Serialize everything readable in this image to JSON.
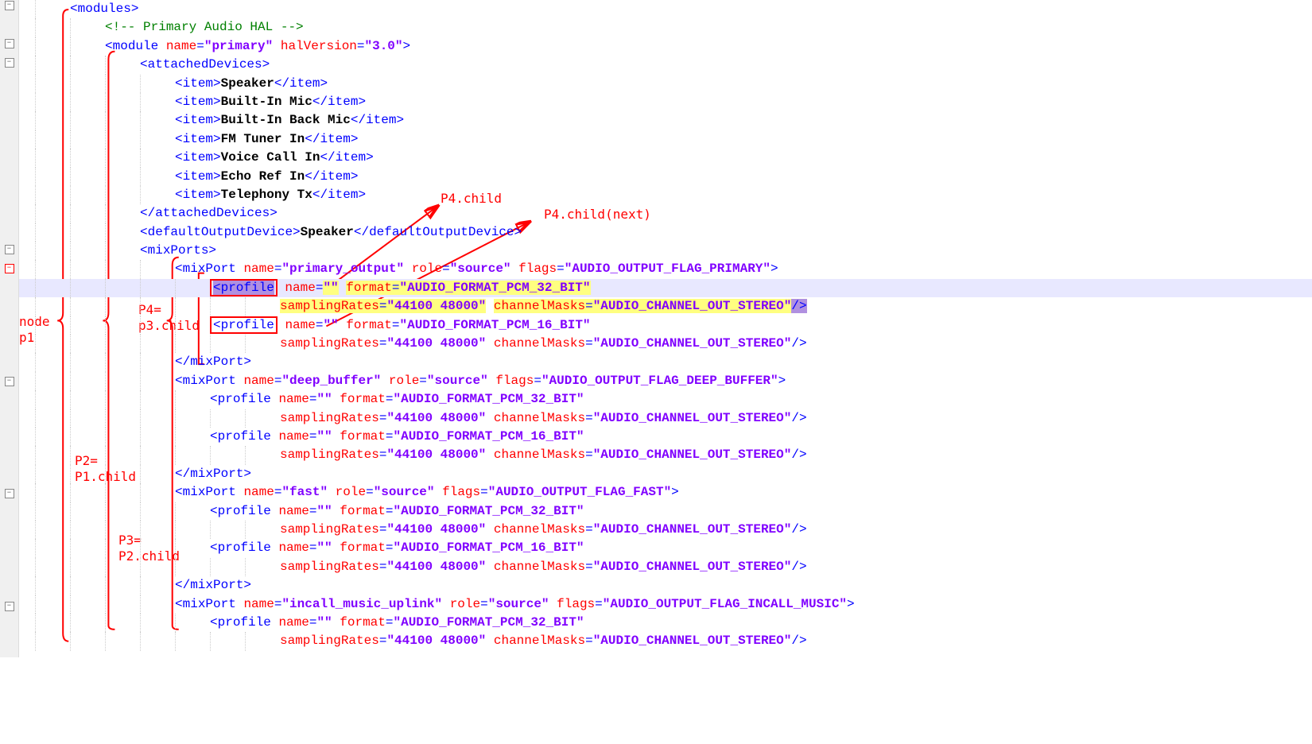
{
  "annotations": {
    "node_p1_a": "node",
    "node_p1_b": "p1",
    "p2_a": "P2=",
    "p2_b": "P1.child",
    "p3_a": "P3=",
    "p3_b": "P2.child",
    "p4_a": "P4=",
    "p4_b": "p3.child",
    "p4_child": "P4.child",
    "p4_child_next": "P4.child(next)"
  },
  "lines": [
    {
      "indent": 1,
      "tokens": [
        {
          "c": "t-bracket",
          "t": "<"
        },
        {
          "c": "t-tag",
          "t": "modules"
        },
        {
          "c": "t-bracket",
          "t": ">"
        }
      ]
    },
    {
      "indent": 2,
      "tokens": [
        {
          "c": "t-comment",
          "t": "<!-- Primary Audio HAL -->"
        }
      ]
    },
    {
      "indent": 2,
      "tokens": [
        {
          "c": "t-bracket",
          "t": "<"
        },
        {
          "c": "t-tag",
          "t": "module"
        },
        {
          "c": "",
          "t": " "
        },
        {
          "c": "t-attr",
          "t": "name"
        },
        {
          "c": "t-tag",
          "t": "="
        },
        {
          "c": "t-str",
          "t": "\"primary\""
        },
        {
          "c": "",
          "t": " "
        },
        {
          "c": "t-attr",
          "t": "halVersion"
        },
        {
          "c": "t-tag",
          "t": "="
        },
        {
          "c": "t-str",
          "t": "\"3.0\""
        },
        {
          "c": "t-bracket",
          "t": ">"
        }
      ]
    },
    {
      "indent": 3,
      "tokens": [
        {
          "c": "t-bracket",
          "t": "<"
        },
        {
          "c": "t-tag",
          "t": "attachedDevices"
        },
        {
          "c": "t-bracket",
          "t": ">"
        }
      ]
    },
    {
      "indent": 4,
      "tokens": [
        {
          "c": "t-bracket",
          "t": "<"
        },
        {
          "c": "t-tag",
          "t": "item"
        },
        {
          "c": "t-bracket",
          "t": ">"
        },
        {
          "c": "t-text",
          "t": "Speaker"
        },
        {
          "c": "t-bracket",
          "t": "</"
        },
        {
          "c": "t-tag",
          "t": "item"
        },
        {
          "c": "t-bracket",
          "t": ">"
        }
      ]
    },
    {
      "indent": 4,
      "tokens": [
        {
          "c": "t-bracket",
          "t": "<"
        },
        {
          "c": "t-tag",
          "t": "item"
        },
        {
          "c": "t-bracket",
          "t": ">"
        },
        {
          "c": "t-text",
          "t": "Built-In Mic"
        },
        {
          "c": "t-bracket",
          "t": "</"
        },
        {
          "c": "t-tag",
          "t": "item"
        },
        {
          "c": "t-bracket",
          "t": ">"
        }
      ]
    },
    {
      "indent": 4,
      "tokens": [
        {
          "c": "t-bracket",
          "t": "<"
        },
        {
          "c": "t-tag",
          "t": "item"
        },
        {
          "c": "t-bracket",
          "t": ">"
        },
        {
          "c": "t-text",
          "t": "Built-In Back Mic"
        },
        {
          "c": "t-bracket",
          "t": "</"
        },
        {
          "c": "t-tag",
          "t": "item"
        },
        {
          "c": "t-bracket",
          "t": ">"
        }
      ]
    },
    {
      "indent": 4,
      "tokens": [
        {
          "c": "t-bracket",
          "t": "<"
        },
        {
          "c": "t-tag",
          "t": "item"
        },
        {
          "c": "t-bracket",
          "t": ">"
        },
        {
          "c": "t-text",
          "t": "FM Tuner In"
        },
        {
          "c": "t-bracket",
          "t": "</"
        },
        {
          "c": "t-tag",
          "t": "item"
        },
        {
          "c": "t-bracket",
          "t": ">"
        }
      ]
    },
    {
      "indent": 4,
      "tokens": [
        {
          "c": "t-bracket",
          "t": "<"
        },
        {
          "c": "t-tag",
          "t": "item"
        },
        {
          "c": "t-bracket",
          "t": ">"
        },
        {
          "c": "t-text",
          "t": "Voice Call In"
        },
        {
          "c": "t-bracket",
          "t": "</"
        },
        {
          "c": "t-tag",
          "t": "item"
        },
        {
          "c": "t-bracket",
          "t": ">"
        }
      ]
    },
    {
      "indent": 4,
      "tokens": [
        {
          "c": "t-bracket",
          "t": "<"
        },
        {
          "c": "t-tag",
          "t": "item"
        },
        {
          "c": "t-bracket",
          "t": ">"
        },
        {
          "c": "t-text",
          "t": "Echo Ref In"
        },
        {
          "c": "t-bracket",
          "t": "</"
        },
        {
          "c": "t-tag",
          "t": "item"
        },
        {
          "c": "t-bracket",
          "t": ">"
        }
      ]
    },
    {
      "indent": 4,
      "tokens": [
        {
          "c": "t-bracket",
          "t": "<"
        },
        {
          "c": "t-tag",
          "t": "item"
        },
        {
          "c": "t-bracket",
          "t": ">"
        },
        {
          "c": "t-text",
          "t": "Telephony Tx"
        },
        {
          "c": "t-bracket",
          "t": "</"
        },
        {
          "c": "t-tag",
          "t": "item"
        },
        {
          "c": "t-bracket",
          "t": ">"
        }
      ]
    },
    {
      "indent": 3,
      "tokens": [
        {
          "c": "t-bracket",
          "t": "</"
        },
        {
          "c": "t-tag",
          "t": "attachedDevices"
        },
        {
          "c": "t-bracket",
          "t": ">"
        }
      ]
    },
    {
      "indent": 3,
      "tokens": [
        {
          "c": "t-bracket",
          "t": "<"
        },
        {
          "c": "t-tag",
          "t": "defaultOutputDevice"
        },
        {
          "c": "t-bracket",
          "t": ">"
        },
        {
          "c": "t-text",
          "t": "Speaker"
        },
        {
          "c": "t-bracket",
          "t": "</"
        },
        {
          "c": "t-tag",
          "t": "defaultOutputDevice"
        },
        {
          "c": "t-bracket",
          "t": ">"
        }
      ]
    },
    {
      "indent": 3,
      "tokens": [
        {
          "c": "t-bracket",
          "t": "<"
        },
        {
          "c": "t-tag",
          "t": "mixPorts"
        },
        {
          "c": "t-bracket",
          "t": ">"
        }
      ]
    },
    {
      "indent": 4,
      "tokens": [
        {
          "c": "t-bracket",
          "t": "<"
        },
        {
          "c": "t-tag",
          "t": "mixPort"
        },
        {
          "c": "",
          "t": " "
        },
        {
          "c": "t-attr",
          "t": "name"
        },
        {
          "c": "t-tag",
          "t": "="
        },
        {
          "c": "t-str",
          "t": "\"primary_output\""
        },
        {
          "c": "",
          "t": " "
        },
        {
          "c": "t-attr",
          "t": "role"
        },
        {
          "c": "t-tag",
          "t": "="
        },
        {
          "c": "t-str",
          "t": "\"source\""
        },
        {
          "c": "",
          "t": " "
        },
        {
          "c": "t-attr",
          "t": "flags"
        },
        {
          "c": "t-tag",
          "t": "="
        },
        {
          "c": "t-str",
          "t": "\"AUDIO_OUTPUT_FLAG_PRIMARY\""
        },
        {
          "c": "t-bracket",
          "t": ">"
        }
      ]
    },
    {
      "indent": 5,
      "highlight": "line",
      "special": "profile1"
    },
    {
      "indent": 7,
      "special": "profile1b"
    },
    {
      "indent": 5,
      "special": "profile2"
    },
    {
      "indent": 7,
      "tokens": [
        {
          "c": "t-attr",
          "t": "samplingRates"
        },
        {
          "c": "t-tag",
          "t": "="
        },
        {
          "c": "t-str",
          "t": "\"44100 48000\""
        },
        {
          "c": "",
          "t": " "
        },
        {
          "c": "t-attr",
          "t": "channelMasks"
        },
        {
          "c": "t-tag",
          "t": "="
        },
        {
          "c": "t-str",
          "t": "\"AUDIO_CHANNEL_OUT_STEREO\""
        },
        {
          "c": "t-bracket",
          "t": "/>"
        }
      ]
    },
    {
      "indent": 4,
      "tokens": [
        {
          "c": "t-bracket",
          "t": "</"
        },
        {
          "c": "t-tag",
          "t": "mixPort"
        },
        {
          "c": "t-bracket",
          "t": ">"
        }
      ]
    },
    {
      "indent": 4,
      "tokens": [
        {
          "c": "t-bracket",
          "t": "<"
        },
        {
          "c": "t-tag",
          "t": "mixPort"
        },
        {
          "c": "",
          "t": " "
        },
        {
          "c": "t-attr",
          "t": "name"
        },
        {
          "c": "t-tag",
          "t": "="
        },
        {
          "c": "t-str",
          "t": "\"deep_buffer\""
        },
        {
          "c": "",
          "t": " "
        },
        {
          "c": "t-attr",
          "t": "role"
        },
        {
          "c": "t-tag",
          "t": "="
        },
        {
          "c": "t-str",
          "t": "\"source\""
        },
        {
          "c": "",
          "t": " "
        },
        {
          "c": "t-attr",
          "t": "flags"
        },
        {
          "c": "t-tag",
          "t": "="
        },
        {
          "c": "t-str",
          "t": "\"AUDIO_OUTPUT_FLAG_DEEP_BUFFER\""
        },
        {
          "c": "t-bracket",
          "t": ">"
        }
      ]
    },
    {
      "indent": 5,
      "tokens": [
        {
          "c": "t-bracket",
          "t": "<"
        },
        {
          "c": "t-tag",
          "t": "profile"
        },
        {
          "c": "",
          "t": " "
        },
        {
          "c": "t-attr",
          "t": "name"
        },
        {
          "c": "t-tag",
          "t": "="
        },
        {
          "c": "t-str",
          "t": "\"\""
        },
        {
          "c": "",
          "t": " "
        },
        {
          "c": "t-attr",
          "t": "format"
        },
        {
          "c": "t-tag",
          "t": "="
        },
        {
          "c": "t-str",
          "t": "\"AUDIO_FORMAT_PCM_32_BIT\""
        }
      ]
    },
    {
      "indent": 7,
      "tokens": [
        {
          "c": "t-attr",
          "t": "samplingRates"
        },
        {
          "c": "t-tag",
          "t": "="
        },
        {
          "c": "t-str",
          "t": "\"44100 48000\""
        },
        {
          "c": "",
          "t": " "
        },
        {
          "c": "t-attr",
          "t": "channelMasks"
        },
        {
          "c": "t-tag",
          "t": "="
        },
        {
          "c": "t-str",
          "t": "\"AUDIO_CHANNEL_OUT_STEREO\""
        },
        {
          "c": "t-bracket",
          "t": "/>"
        }
      ]
    },
    {
      "indent": 5,
      "tokens": [
        {
          "c": "t-bracket",
          "t": "<"
        },
        {
          "c": "t-tag",
          "t": "profile"
        },
        {
          "c": "",
          "t": " "
        },
        {
          "c": "t-attr",
          "t": "name"
        },
        {
          "c": "t-tag",
          "t": "="
        },
        {
          "c": "t-str",
          "t": "\"\""
        },
        {
          "c": "",
          "t": " "
        },
        {
          "c": "t-attr",
          "t": "format"
        },
        {
          "c": "t-tag",
          "t": "="
        },
        {
          "c": "t-str",
          "t": "\"AUDIO_FORMAT_PCM_16_BIT\""
        }
      ]
    },
    {
      "indent": 7,
      "tokens": [
        {
          "c": "t-attr",
          "t": "samplingRates"
        },
        {
          "c": "t-tag",
          "t": "="
        },
        {
          "c": "t-str",
          "t": "\"44100 48000\""
        },
        {
          "c": "",
          "t": " "
        },
        {
          "c": "t-attr",
          "t": "channelMasks"
        },
        {
          "c": "t-tag",
          "t": "="
        },
        {
          "c": "t-str",
          "t": "\"AUDIO_CHANNEL_OUT_STEREO\""
        },
        {
          "c": "t-bracket",
          "t": "/>"
        }
      ]
    },
    {
      "indent": 4,
      "tokens": [
        {
          "c": "t-bracket",
          "t": "</"
        },
        {
          "c": "t-tag",
          "t": "mixPort"
        },
        {
          "c": "t-bracket",
          "t": ">"
        }
      ]
    },
    {
      "indent": 4,
      "tokens": [
        {
          "c": "t-bracket",
          "t": "<"
        },
        {
          "c": "t-tag",
          "t": "mixPort"
        },
        {
          "c": "",
          "t": " "
        },
        {
          "c": "t-attr",
          "t": "name"
        },
        {
          "c": "t-tag",
          "t": "="
        },
        {
          "c": "t-str",
          "t": "\"fast\""
        },
        {
          "c": "",
          "t": " "
        },
        {
          "c": "t-attr",
          "t": "role"
        },
        {
          "c": "t-tag",
          "t": "="
        },
        {
          "c": "t-str",
          "t": "\"source\""
        },
        {
          "c": "",
          "t": " "
        },
        {
          "c": "t-attr",
          "t": "flags"
        },
        {
          "c": "t-tag",
          "t": "="
        },
        {
          "c": "t-str",
          "t": "\"AUDIO_OUTPUT_FLAG_FAST\""
        },
        {
          "c": "t-bracket",
          "t": ">"
        }
      ]
    },
    {
      "indent": 5,
      "tokens": [
        {
          "c": "t-bracket",
          "t": "<"
        },
        {
          "c": "t-tag",
          "t": "profile"
        },
        {
          "c": "",
          "t": " "
        },
        {
          "c": "t-attr",
          "t": "name"
        },
        {
          "c": "t-tag",
          "t": "="
        },
        {
          "c": "t-str",
          "t": "\"\""
        },
        {
          "c": "",
          "t": " "
        },
        {
          "c": "t-attr",
          "t": "format"
        },
        {
          "c": "t-tag",
          "t": "="
        },
        {
          "c": "t-str",
          "t": "\"AUDIO_FORMAT_PCM_32_BIT\""
        }
      ]
    },
    {
      "indent": 7,
      "tokens": [
        {
          "c": "t-attr",
          "t": "samplingRates"
        },
        {
          "c": "t-tag",
          "t": "="
        },
        {
          "c": "t-str",
          "t": "\"44100 48000\""
        },
        {
          "c": "",
          "t": " "
        },
        {
          "c": "t-attr",
          "t": "channelMasks"
        },
        {
          "c": "t-tag",
          "t": "="
        },
        {
          "c": "t-str",
          "t": "\"AUDIO_CHANNEL_OUT_STEREO\""
        },
        {
          "c": "t-bracket",
          "t": "/>"
        }
      ]
    },
    {
      "indent": 5,
      "tokens": [
        {
          "c": "t-bracket",
          "t": "<"
        },
        {
          "c": "t-tag",
          "t": "profile"
        },
        {
          "c": "",
          "t": " "
        },
        {
          "c": "t-attr",
          "t": "name"
        },
        {
          "c": "t-tag",
          "t": "="
        },
        {
          "c": "t-str",
          "t": "\"\""
        },
        {
          "c": "",
          "t": " "
        },
        {
          "c": "t-attr",
          "t": "format"
        },
        {
          "c": "t-tag",
          "t": "="
        },
        {
          "c": "t-str",
          "t": "\"AUDIO_FORMAT_PCM_16_BIT\""
        }
      ]
    },
    {
      "indent": 7,
      "tokens": [
        {
          "c": "t-attr",
          "t": "samplingRates"
        },
        {
          "c": "t-tag",
          "t": "="
        },
        {
          "c": "t-str",
          "t": "\"44100 48000\""
        },
        {
          "c": "",
          "t": " "
        },
        {
          "c": "t-attr",
          "t": "channelMasks"
        },
        {
          "c": "t-tag",
          "t": "="
        },
        {
          "c": "t-str",
          "t": "\"AUDIO_CHANNEL_OUT_STEREO\""
        },
        {
          "c": "t-bracket",
          "t": "/>"
        }
      ]
    },
    {
      "indent": 4,
      "tokens": [
        {
          "c": "t-bracket",
          "t": "</"
        },
        {
          "c": "t-tag",
          "t": "mixPort"
        },
        {
          "c": "t-bracket",
          "t": ">"
        }
      ]
    },
    {
      "indent": 4,
      "tokens": [
        {
          "c": "t-bracket",
          "t": "<"
        },
        {
          "c": "t-tag",
          "t": "mixPort"
        },
        {
          "c": "",
          "t": " "
        },
        {
          "c": "t-attr",
          "t": "name"
        },
        {
          "c": "t-tag",
          "t": "="
        },
        {
          "c": "t-str",
          "t": "\"incall_music_uplink\""
        },
        {
          "c": "",
          "t": " "
        },
        {
          "c": "t-attr",
          "t": "role"
        },
        {
          "c": "t-tag",
          "t": "="
        },
        {
          "c": "t-str",
          "t": "\"source\""
        },
        {
          "c": "",
          "t": " "
        },
        {
          "c": "t-attr",
          "t": "flags"
        },
        {
          "c": "t-tag",
          "t": "="
        },
        {
          "c": "t-str",
          "t": "\"AUDIO_OUTPUT_FLAG_INCALL_MUSIC\""
        },
        {
          "c": "t-bracket",
          "t": ">"
        }
      ]
    },
    {
      "indent": 5,
      "tokens": [
        {
          "c": "t-bracket",
          "t": "<"
        },
        {
          "c": "t-tag",
          "t": "profile"
        },
        {
          "c": "",
          "t": " "
        },
        {
          "c": "t-attr",
          "t": "name"
        },
        {
          "c": "t-tag",
          "t": "="
        },
        {
          "c": "t-str",
          "t": "\"\""
        },
        {
          "c": "",
          "t": " "
        },
        {
          "c": "t-attr",
          "t": "format"
        },
        {
          "c": "t-tag",
          "t": "="
        },
        {
          "c": "t-str",
          "t": "\"AUDIO_FORMAT_PCM_32_BIT\""
        }
      ]
    },
    {
      "indent": 7,
      "tokens": [
        {
          "c": "t-attr",
          "t": "samplingRates"
        },
        {
          "c": "t-tag",
          "t": "="
        },
        {
          "c": "t-str",
          "t": "\"44100 48000\""
        },
        {
          "c": "",
          "t": " "
        },
        {
          "c": "t-attr",
          "t": "channelMasks"
        },
        {
          "c": "t-tag",
          "t": "="
        },
        {
          "c": "t-str",
          "t": "\"AUDIO_CHANNEL_OUT_STEREO\""
        },
        {
          "c": "t-bracket",
          "t": "/>"
        }
      ]
    }
  ],
  "fold_positions": [
    0,
    2,
    3,
    13,
    14,
    20,
    26,
    32
  ],
  "fold_red": 14
}
